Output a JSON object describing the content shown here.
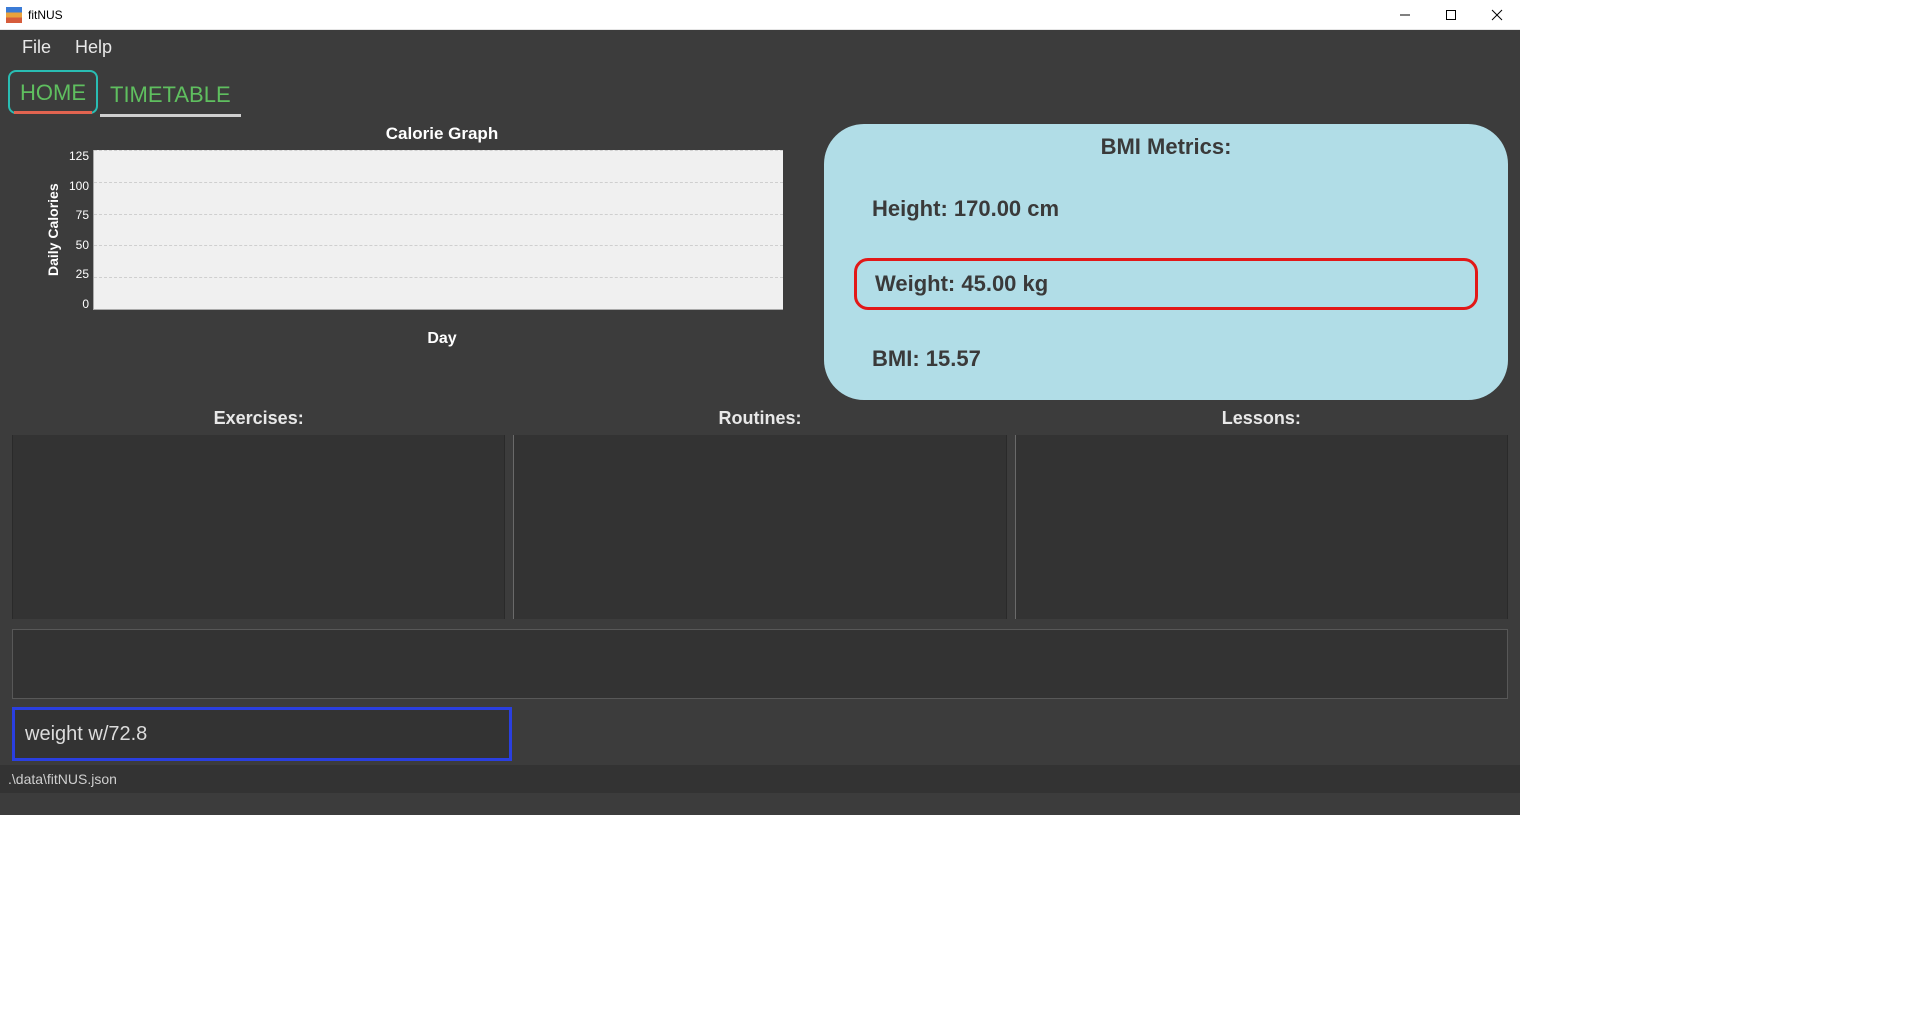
{
  "window": {
    "title": "fitNUS"
  },
  "menubar": {
    "file": "File",
    "help": "Help"
  },
  "tabs": {
    "home": "HOME",
    "timetable": "TIMETABLE"
  },
  "chart_data": {
    "type": "bar",
    "title": "Calorie Graph",
    "xlabel": "Day",
    "ylabel": "Daily Calories",
    "categories": [],
    "values": [],
    "ylim": [
      0,
      125
    ],
    "yticks": [
      125,
      100,
      75,
      50,
      25,
      0
    ]
  },
  "bmi": {
    "title": "BMI Metrics:",
    "height_label": "Height: 170.00 cm",
    "weight_label": "Weight: 45.00 kg",
    "bmi_label": "BMI: 15.57",
    "height_value": 170.0,
    "weight_value": 45.0,
    "bmi_value": 15.57
  },
  "lists": {
    "exercises_title": "Exercises:",
    "routines_title": "Routines:",
    "lessons_title": "Lessons:"
  },
  "command": {
    "value": "weight w/72.8"
  },
  "statusbar": {
    "path": ".\\data\\fitNUS.json"
  }
}
